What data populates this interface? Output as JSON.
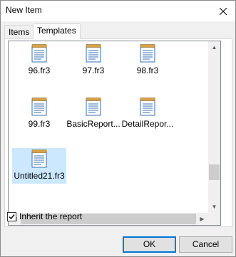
{
  "window": {
    "title": "New Item"
  },
  "tabs": [
    {
      "label": "Items",
      "active": false
    },
    {
      "label": "Templates",
      "active": true
    }
  ],
  "items": [
    {
      "label": "96.fr3",
      "selected": false
    },
    {
      "label": "97.fr3",
      "selected": false
    },
    {
      "label": "98.fr3",
      "selected": false
    },
    {
      "label": "99.fr3",
      "selected": false
    },
    {
      "label": "BasicReport...",
      "selected": false
    },
    {
      "label": "DetailRepor...",
      "selected": false
    },
    {
      "label": "Untitled21.fr3",
      "selected": true
    }
  ],
  "options": {
    "inherit_label": "Inherit the report",
    "inherit_checked": true
  },
  "buttons": {
    "ok_label": "OK",
    "cancel_label": "Cancel"
  },
  "icon_names": {
    "item_icon": "report-file-icon",
    "close": "close-icon"
  },
  "colors": {
    "selection": "#cce8ff",
    "default_button_border": "#0078d7"
  }
}
